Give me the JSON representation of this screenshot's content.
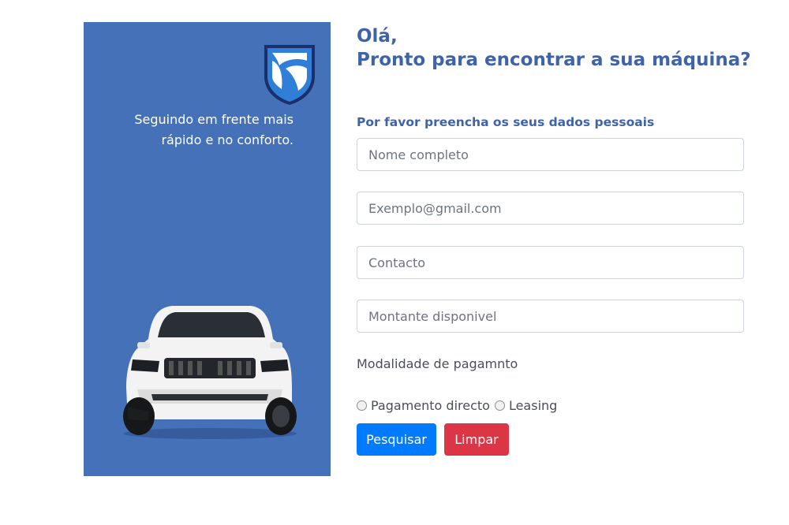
{
  "colors": {
    "panel_bg": "#4571b9",
    "heading": "#3f63a8",
    "primary_button": "#007bff",
    "danger_button": "#dc3545"
  },
  "side_panel": {
    "logo_icon": "bank-shield-logo-icon",
    "tagline_line1": "Seguindo em frente mais",
    "tagline_line2": "rápido e no conforto.",
    "car_image": "white-suv-image"
  },
  "header": {
    "greeting_line1": "Olá,",
    "greeting_line2": "Pronto para encontrar a sua máquina?"
  },
  "form": {
    "intro": "Por favor preencha os seus dados pessoais",
    "fields": {
      "name": {
        "placeholder": "Nome completo",
        "value": ""
      },
      "email": {
        "placeholder": "Exemplo@gmail.com",
        "value": ""
      },
      "contact": {
        "placeholder": "Contacto",
        "value": ""
      },
      "amount": {
        "placeholder": "Montante disponivel",
        "value": ""
      }
    },
    "payment_label": "Modalidade de pagamnto",
    "payment_options": [
      "Pagamento directo",
      "Leasing"
    ],
    "buttons": {
      "search": "Pesquisar",
      "clear": "Limpar"
    }
  }
}
